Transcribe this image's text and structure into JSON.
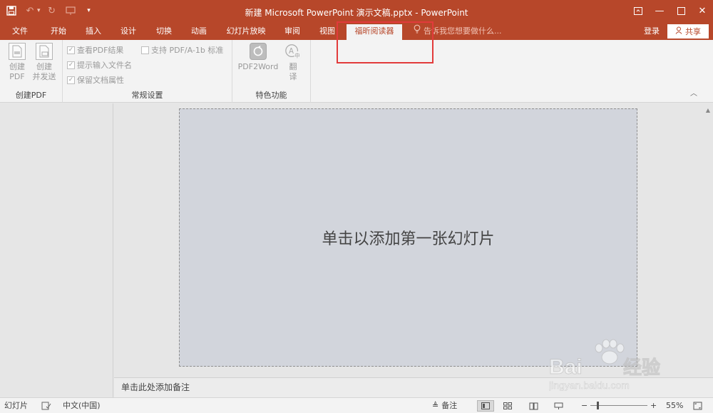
{
  "window": {
    "title": "新建 Microsoft PowerPoint 演示文稿.pptx - PowerPoint"
  },
  "qat": {
    "save_icon": "save-icon",
    "undo_icon": "undo-icon",
    "redo_icon": "redo-icon",
    "present_icon": "start-presentation-icon",
    "customize_icon": "customize-qat-icon"
  },
  "tabs": [
    {
      "label": "文件"
    },
    {
      "label": "开始"
    },
    {
      "label": "插入"
    },
    {
      "label": "设计"
    },
    {
      "label": "切换"
    },
    {
      "label": "动画"
    },
    {
      "label": "幻灯片放映"
    },
    {
      "label": "审阅"
    },
    {
      "label": "视图"
    },
    {
      "label": "福昕阅读器",
      "active": true
    }
  ],
  "tellme": {
    "placeholder": "告诉我您想要做什么..."
  },
  "account": {
    "signin": "登录",
    "share": "共享"
  },
  "ribbon": {
    "groups": [
      {
        "label": "创建PDF",
        "buttons": [
          {
            "line1": "创建",
            "line2": "PDF"
          },
          {
            "line1": "创建",
            "line2": "并发送"
          }
        ]
      },
      {
        "label": "常规设置",
        "checkboxes": [
          {
            "label": "查看PDF结果",
            "checked": true
          },
          {
            "label": "提示输入文件名",
            "checked": true
          },
          {
            "label": "保留文档属性",
            "checked": true
          },
          {
            "label": "支持 PDF/A-1b 标准",
            "checked": false
          }
        ]
      },
      {
        "label": "特色功能",
        "buttons": [
          {
            "label": "PDF2Word"
          },
          {
            "line1": "翻",
            "line2": "译"
          }
        ]
      }
    ]
  },
  "slide": {
    "placeholder": "单击以添加第一张幻灯片"
  },
  "notes": {
    "placeholder": "单击此处添加备注"
  },
  "watermark": {
    "brand": "Bai du 经验",
    "url": "jingyan.baidu.com"
  },
  "statusbar": {
    "slide_label": "幻灯片",
    "language": "中文(中国)",
    "notes": "备注",
    "zoom": "55%"
  },
  "colors": {
    "accent": "#b7472a",
    "highlight": "#e23b3b"
  }
}
